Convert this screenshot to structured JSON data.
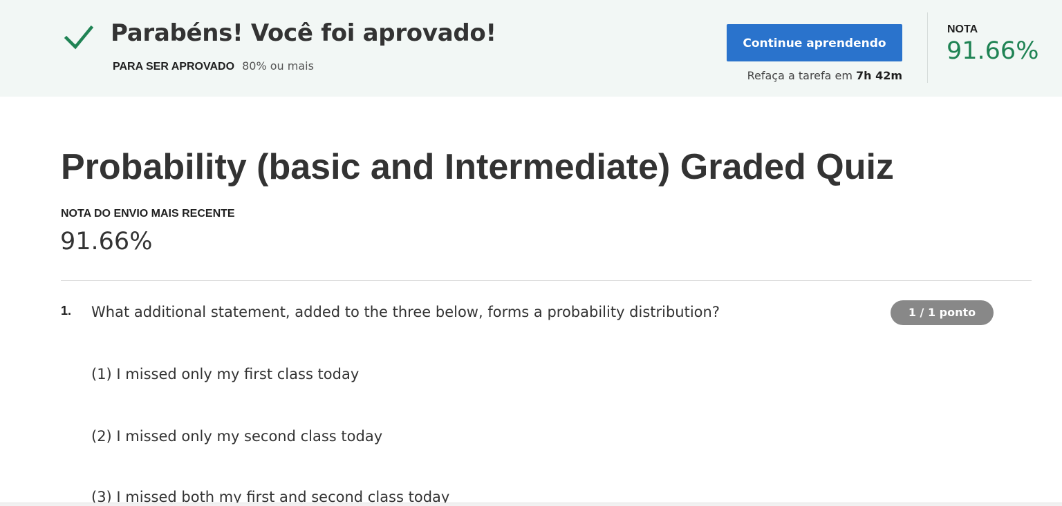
{
  "banner": {
    "title": "Parabéns! Você foi aprovado!",
    "pass_label": "PARA SER APROVADO",
    "pass_value": "80% ou mais",
    "continue_label": "Continue aprendendo",
    "retake_prefix": "Refaça a tarefa em",
    "retake_time": "7h 42m",
    "grade_label": "NOTA",
    "grade_value": "91.66%",
    "accent_color": "#1f8354",
    "button_color": "#2a73cc",
    "icon": "check-icon"
  },
  "main": {
    "title": "Probability (basic and Intermediate) Graded Quiz",
    "recent_label": "NOTA DO ENVIO MAIS RECENTE",
    "recent_value": "91.66%",
    "questions": [
      {
        "number": "1.",
        "text": "What additional statement, added to the three below, forms a probability distribution?",
        "points": "1 / 1 ponto",
        "statements": [
          "(1) I missed only my first class today",
          "(2) I missed only my second class today",
          "(3) I missed both my first and second class today"
        ]
      }
    ]
  }
}
